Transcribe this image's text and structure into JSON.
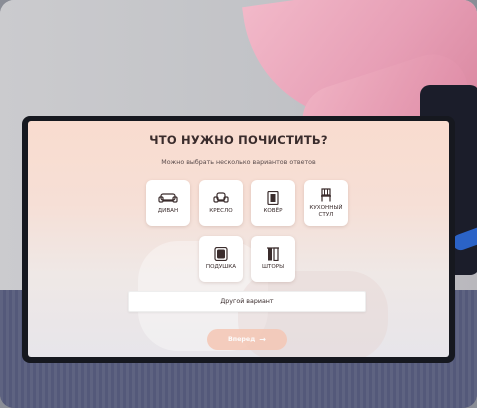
{
  "quiz": {
    "title": "ЧТО НУЖНО ПОЧИСТИТЬ?",
    "subtitle": "Можно выбрать несколько вариантов ответов",
    "options": [
      {
        "label": "ДИВАН",
        "icon": "sofa-icon"
      },
      {
        "label": "КРЕСЛО",
        "icon": "armchair-icon"
      },
      {
        "label": "КОВЁР",
        "icon": "carpet-icon"
      },
      {
        "label": "КУХОННЫЙ СТУЛ",
        "icon": "kitchen-chair-icon"
      },
      {
        "label": "ПОДУШКА",
        "icon": "pillow-icon"
      },
      {
        "label": "ШТОРЫ",
        "icon": "curtains-icon"
      }
    ],
    "other_label": "Другой вариант",
    "next_label": "Вперед",
    "next_arrow": "→"
  },
  "colors": {
    "accent": "#f5c7b5",
    "text": "#3a2c2c",
    "card": "#ffffff"
  }
}
